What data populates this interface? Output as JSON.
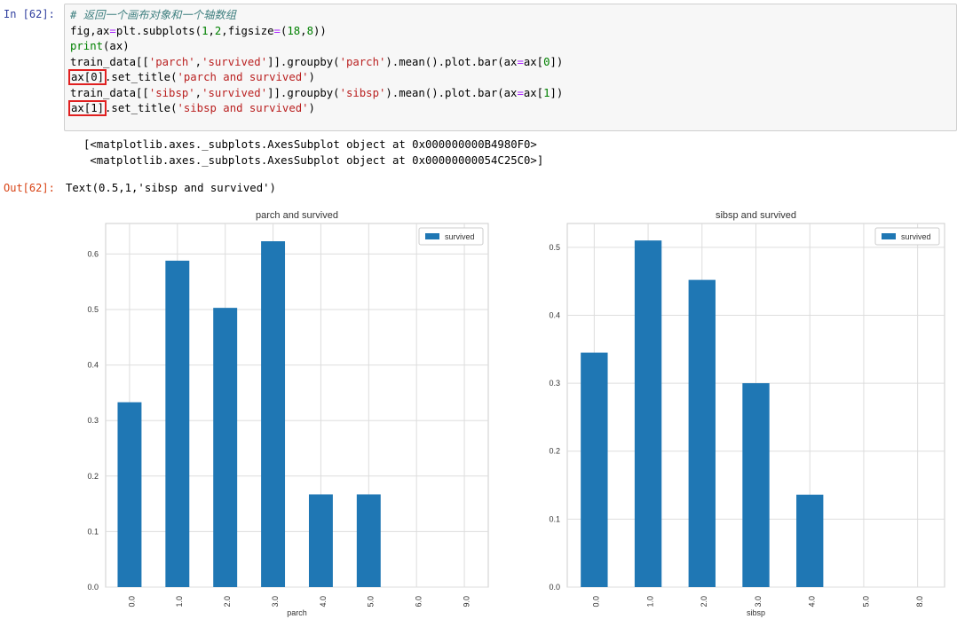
{
  "cell": {
    "in_prompt": "In  [62]:",
    "out_prompt": "Out[62]:",
    "code": [
      [
        {
          "t": "# 返回一个画布对象和一个轴数组",
          "c": "cm-comment"
        }
      ],
      [
        {
          "t": "fig,ax"
        },
        {
          "t": "=",
          "c": "cm-op"
        },
        {
          "t": "plt.subplots("
        },
        {
          "t": "1",
          "c": "cm-number"
        },
        {
          "t": ","
        },
        {
          "t": "2",
          "c": "cm-number"
        },
        {
          "t": ",figsize"
        },
        {
          "t": "=",
          "c": "cm-op"
        },
        {
          "t": "("
        },
        {
          "t": "18",
          "c": "cm-number"
        },
        {
          "t": ","
        },
        {
          "t": "8",
          "c": "cm-number"
        },
        {
          "t": "))"
        }
      ],
      [
        {
          "t": "print",
          "c": "cm-builtin"
        },
        {
          "t": "(ax)"
        }
      ],
      [
        {
          "t": "train_data[["
        },
        {
          "t": "'parch'",
          "c": "cm-string"
        },
        {
          "t": ","
        },
        {
          "t": "'survived'",
          "c": "cm-string"
        },
        {
          "t": "]].groupby("
        },
        {
          "t": "'parch'",
          "c": "cm-string"
        },
        {
          "t": ").mean().plot.bar(ax"
        },
        {
          "t": "=",
          "c": "cm-op"
        },
        {
          "t": "ax["
        },
        {
          "t": "0",
          "c": "cm-number"
        },
        {
          "t": "])"
        }
      ],
      [
        {
          "t": "ax[0]",
          "c": "hl"
        },
        {
          "t": ".set_title("
        },
        {
          "t": "'parch and survived'",
          "c": "cm-string"
        },
        {
          "t": ")"
        }
      ],
      [
        {
          "t": "train_data[["
        },
        {
          "t": "'sibsp'",
          "c": "cm-string"
        },
        {
          "t": ","
        },
        {
          "t": "'survived'",
          "c": "cm-string"
        },
        {
          "t": "]].groupby("
        },
        {
          "t": "'sibsp'",
          "c": "cm-string"
        },
        {
          "t": ").mean().plot.bar(ax"
        },
        {
          "t": "=",
          "c": "cm-op"
        },
        {
          "t": "ax["
        },
        {
          "t": "1",
          "c": "cm-number"
        },
        {
          "t": "])"
        }
      ],
      [
        {
          "t": "ax[1]",
          "c": "hl"
        },
        {
          "t": ".set_title("
        },
        {
          "t": "'sibsp and survived'",
          "c": "cm-string"
        },
        {
          "t": ")"
        }
      ]
    ],
    "stdout": [
      "[<matplotlib.axes._subplots.AxesSubplot object at 0x000000000B4980F0>",
      " <matplotlib.axes._subplots.AxesSubplot object at 0x00000000054C25C0>]"
    ],
    "result": "Text(0.5,1,'sibsp and survived')"
  },
  "colors": {
    "bar": "#1f77b4",
    "grid": "#dddddd",
    "axes_edge": "#cccccc",
    "text": "#333333",
    "highlight": "#e02020"
  },
  "chart_data": [
    {
      "type": "bar",
      "title": "parch and survived",
      "xlabel": "parch",
      "ylabel": "",
      "categories": [
        "0.0",
        "1.0",
        "2.0",
        "3.0",
        "4.0",
        "5.0",
        "6.0",
        "9.0"
      ],
      "series": [
        {
          "name": "survived",
          "values": [
            0.333,
            0.588,
            0.503,
            0.623,
            0.167,
            0.167,
            0.0,
            0.0
          ]
        }
      ],
      "ylim": [
        0,
        0.655
      ],
      "yticks": [
        0.0,
        0.1,
        0.2,
        0.3,
        0.4,
        0.5,
        0.6
      ],
      "ytick_labels": [
        "0.0",
        "0.1",
        "0.2",
        "0.3",
        "0.4",
        "0.5",
        "0.6"
      ],
      "grid": true,
      "legend": "top-right"
    },
    {
      "type": "bar",
      "title": "sibsp and survived",
      "xlabel": "sibsp",
      "ylabel": "",
      "categories": [
        "0.0",
        "1.0",
        "2.0",
        "3.0",
        "4.0",
        "5.0",
        "8.0"
      ],
      "series": [
        {
          "name": "survived",
          "values": [
            0.345,
            0.51,
            0.452,
            0.3,
            0.136,
            0.0,
            0.0
          ]
        }
      ],
      "ylim": [
        0,
        0.535
      ],
      "yticks": [
        0.0,
        0.1,
        0.2,
        0.3,
        0.4,
        0.5
      ],
      "ytick_labels": [
        "0.0",
        "0.1",
        "0.2",
        "0.3",
        "0.4",
        "0.5"
      ],
      "grid": true,
      "legend": "top-right"
    }
  ]
}
